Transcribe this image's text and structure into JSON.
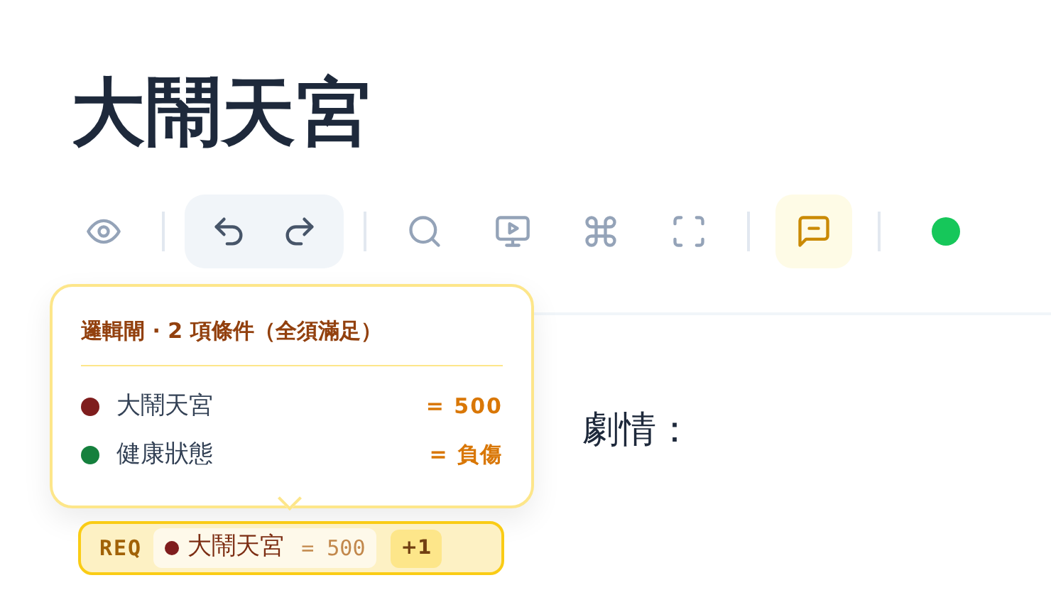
{
  "title": "大鬧天宮",
  "toolbar": [
    {
      "kind": "button",
      "selected": false
    },
    {
      "kind": "separator"
    },
    {
      "kind": "group",
      "buttons": [
        {
          "selected": false
        },
        {
          "selected": false
        }
      ]
    },
    {
      "kind": "separator"
    },
    {
      "kind": "button",
      "selected": false
    },
    {
      "kind": "button",
      "selected": false
    },
    {
      "kind": "button",
      "selected": false
    },
    {
      "kind": "button",
      "selected": false
    },
    {
      "kind": "separator"
    },
    {
      "kind": "button",
      "selected": true
    },
    {
      "kind": "separator"
    },
    {
      "kind": "dot",
      "color": "#16c75a"
    }
  ],
  "body_text": "劇情：",
  "tooltip": {
    "title": "邏輯閘 · 2 項條件（全須滿足）",
    "conditions": [
      {
        "name": "大鬧天宮",
        "color": "#7f1d1d",
        "value": "= 500"
      },
      {
        "name": "健康狀態",
        "color": "#15803d",
        "value": "= 負傷"
      }
    ]
  },
  "requirement": {
    "label": "REQ",
    "name": "大鬧天宮",
    "color": "#7f1d1d",
    "value": "= 500",
    "more": "+1"
  }
}
